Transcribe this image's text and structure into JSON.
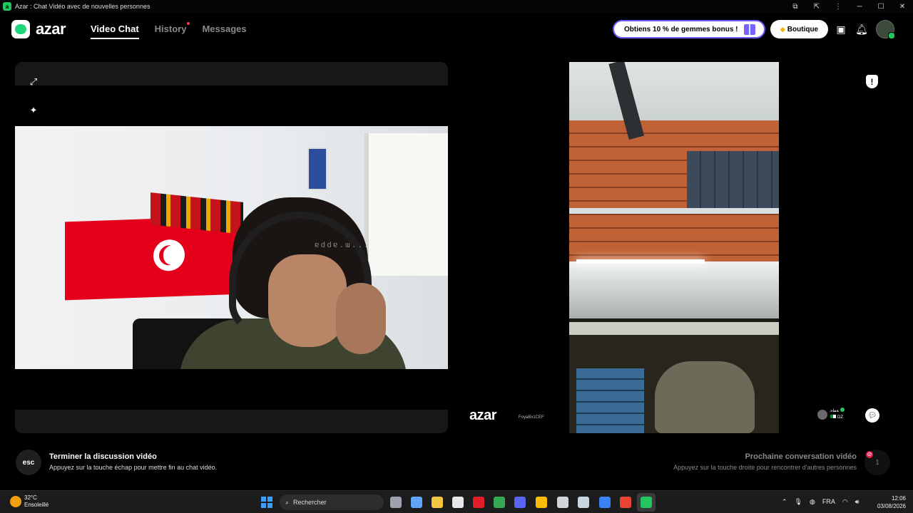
{
  "window": {
    "title": "Azar : Chat Vidéo avec de nouvelles personnes",
    "controls": [
      "⧉",
      "⇱",
      "⋮",
      "─",
      "☐",
      "✕"
    ]
  },
  "header": {
    "brand": "azar",
    "nav": [
      {
        "label": "Video Chat",
        "active": true
      },
      {
        "label": "History",
        "active": false,
        "notification_dot": true
      },
      {
        "label": "Messages",
        "active": false
      }
    ],
    "promo_label": "Obtiens 10 % de gemmes bonus !",
    "shop_label": "Boutique",
    "icons": [
      "store-icon",
      "bell-icon",
      "profile-avatar"
    ]
  },
  "left_panel": {
    "buttons": [
      "expand-icon",
      "magic-wand-icon"
    ],
    "watermark": "ɐddɐ.ɯ... ɐɯɹɐp ʇsnɾ"
  },
  "right_panel": {
    "brand_watermark": "azar",
    "username": "FoyaBx1CEF",
    "peer": {
      "name": "ﺔﻄﺣ",
      "country": "DZ",
      "online": true
    },
    "buttons": [
      "shield-icon",
      "chat-icon"
    ]
  },
  "controls": {
    "end": {
      "key": "esc",
      "title": "Terminer la discussion vidéo",
      "subtitle": "Appuyez sur la touche échap pour mettre fin au chat vidéo."
    },
    "next": {
      "title": "Prochaine conversation vidéo",
      "subtitle": "Appuyez sur la touche droite pour rencontrer d'autres personnes",
      "count": "1"
    }
  },
  "taskbar": {
    "weather": {
      "temp": "32°C",
      "condition": "Ensoleillé"
    },
    "search_placeholder": "Rechercher",
    "language": "FRA",
    "time": "12:06",
    "date": "03/08/2026",
    "apps": [
      {
        "name": "files-icon",
        "color": "#9ca3af"
      },
      {
        "name": "app-a-icon",
        "color": "#60a5fa"
      },
      {
        "name": "folder-icon",
        "color": "#f5c542"
      },
      {
        "name": "store-icon",
        "color": "#e5e7eb"
      },
      {
        "name": "opera-icon",
        "color": "#e11d2a"
      },
      {
        "name": "chrome-alt-icon",
        "color": "#34a853"
      },
      {
        "name": "discord-icon",
        "color": "#5865f2"
      },
      {
        "name": "chrome-icon",
        "color": "#fbbc05"
      },
      {
        "name": "app-dark-icon",
        "color": "#d1d5db"
      },
      {
        "name": "steam-icon",
        "color": "#c7d5e0"
      },
      {
        "name": "vscode-icon",
        "color": "#3b82f6"
      },
      {
        "name": "chrome-profile-icon",
        "color": "#ea4335"
      },
      {
        "name": "azar-icon",
        "color": "#22c55e"
      }
    ]
  }
}
